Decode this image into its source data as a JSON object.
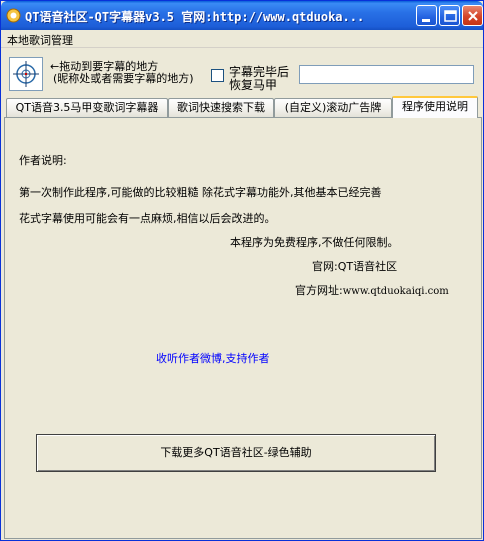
{
  "window": {
    "title": "QT语音社区-QT字幕器v3.5 官网:http://www.qtduoka...",
    "colors": {
      "titlebar": "#2870e6",
      "face": "#ece9d8",
      "link": "#0000ff",
      "active_tab_accent": "#ffc83c"
    }
  },
  "menu": {
    "item_local_lyrics": "本地歌词管理"
  },
  "toolbar": {
    "drag_hint_line1": "←拖动到要字幕的地方",
    "drag_hint_line2": "(昵称处或者需要字幕的地方)",
    "checkbox_label_line1": "字幕完毕后",
    "checkbox_label_line2": "恢复马甲",
    "checkbox_checked": false,
    "text_input_value": ""
  },
  "tabs": [
    {
      "label": "QT语音3.5马甲变歌词字幕器",
      "active": false
    },
    {
      "label": "歌词快速搜索下载",
      "active": false
    },
    {
      "label": "(自定义)滚动广告牌",
      "active": false
    },
    {
      "label": "程序使用说明",
      "active": true
    }
  ],
  "content": {
    "author_heading": "作者说明:",
    "para_line1": "第一次制作此程序,可能做的比较粗糙 除花式字幕功能外,其他基本已经完善",
    "para_line2": "花式字幕使用可能会有一点麻烦,相信以后会改进的。",
    "free_notice": "本程序为免费程序,不做任何限制。",
    "official_site": "官网:QT语音社区",
    "official_url_label": "官方网址:",
    "official_url_value": "www.qtduokaiqi.com",
    "support_link": "收听作者微博,支持作者",
    "download_button": "下载更多QT语音社区-绿色辅助"
  },
  "icons": {
    "app": "app-icon",
    "minimize": "minimize-icon",
    "maximize": "maximize-icon",
    "close": "close-icon",
    "crosshair": "crosshair-icon"
  }
}
